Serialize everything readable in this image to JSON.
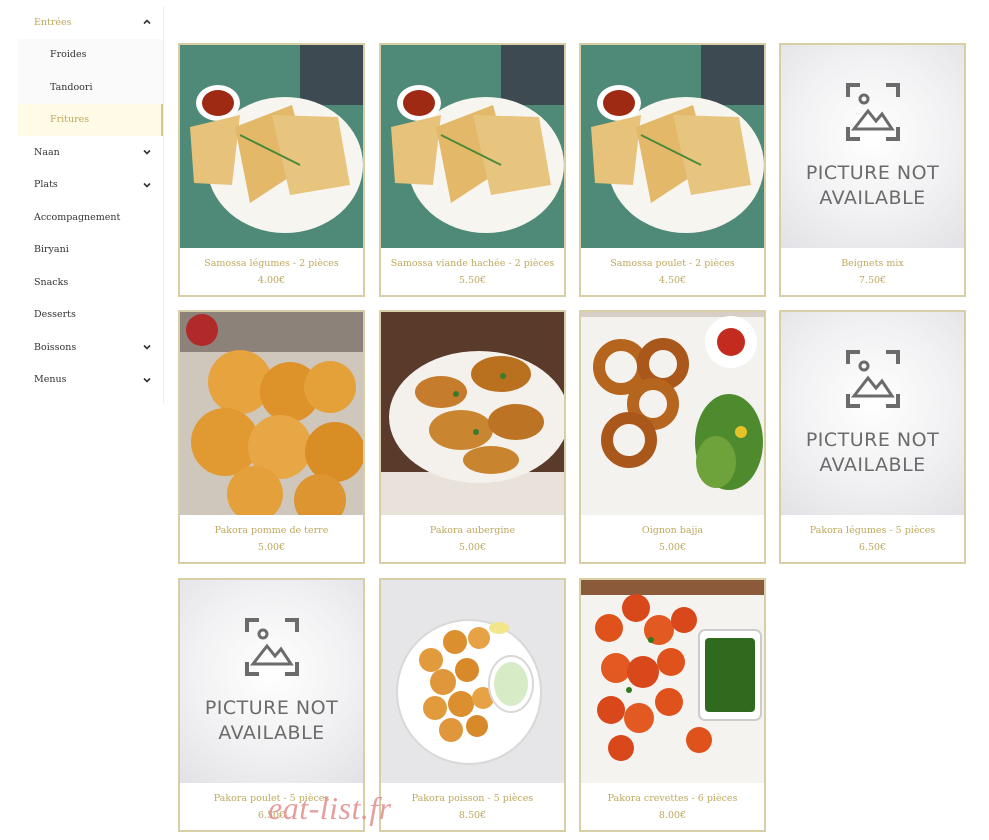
{
  "sidebar": {
    "items": [
      {
        "label": "Entrées",
        "expanded": true,
        "has_chevron": true
      },
      {
        "label": "Froides",
        "sub": true
      },
      {
        "label": "Tandoori",
        "sub": true
      },
      {
        "label": "Fritures",
        "sub": true,
        "current": true
      },
      {
        "label": "Naan",
        "has_chevron": true
      },
      {
        "label": "Plats",
        "has_chevron": true
      },
      {
        "label": "Accompagnement"
      },
      {
        "label": "Biryani"
      },
      {
        "label": "Snacks"
      },
      {
        "label": "Desserts"
      },
      {
        "label": "Boissons",
        "has_chevron": true
      },
      {
        "label": "Menus",
        "has_chevron": true
      }
    ]
  },
  "products": [
    {
      "name": "Samossa légumes - 2 pièces",
      "price": "4.00€",
      "image": "samosa"
    },
    {
      "name": "Samossa viande hachée - 2 pièces",
      "price": "5.50€",
      "image": "samosa"
    },
    {
      "name": "Samossa poulet - 2 pièces",
      "price": "4.50€",
      "image": "samosa"
    },
    {
      "name": "Beignets mix",
      "price": "7.50€",
      "image": "not-available"
    },
    {
      "name": "Pakora pomme de terre",
      "price": "5.00€",
      "image": "potato-pakora"
    },
    {
      "name": "Pakora aubergine",
      "price": "5.00€",
      "image": "eggplant-pakora"
    },
    {
      "name": "Oignon bajja",
      "price": "5.00€",
      "image": "onion-rings"
    },
    {
      "name": "Pakora légumes - 5 pièces",
      "price": "6.50€",
      "image": "not-available"
    },
    {
      "name": "Pakora poulet - 5 pièces",
      "price": "6.50€",
      "image": "not-available"
    },
    {
      "name": "Pakora poisson - 5 pièces",
      "price": "8.50€",
      "image": "fish-pakora"
    },
    {
      "name": "Pakora crevettes - 6 pièces",
      "price": "8.00€",
      "image": "shrimp-pakora"
    }
  ],
  "placeholder": {
    "line1": "PICTURE NOT",
    "line2": "AVAILABLE"
  },
  "watermark": "eat-list.fr",
  "colors": {
    "accent": "#bfa85e",
    "card_border": "#d9cfa6",
    "watermark": "#e08e8e"
  }
}
